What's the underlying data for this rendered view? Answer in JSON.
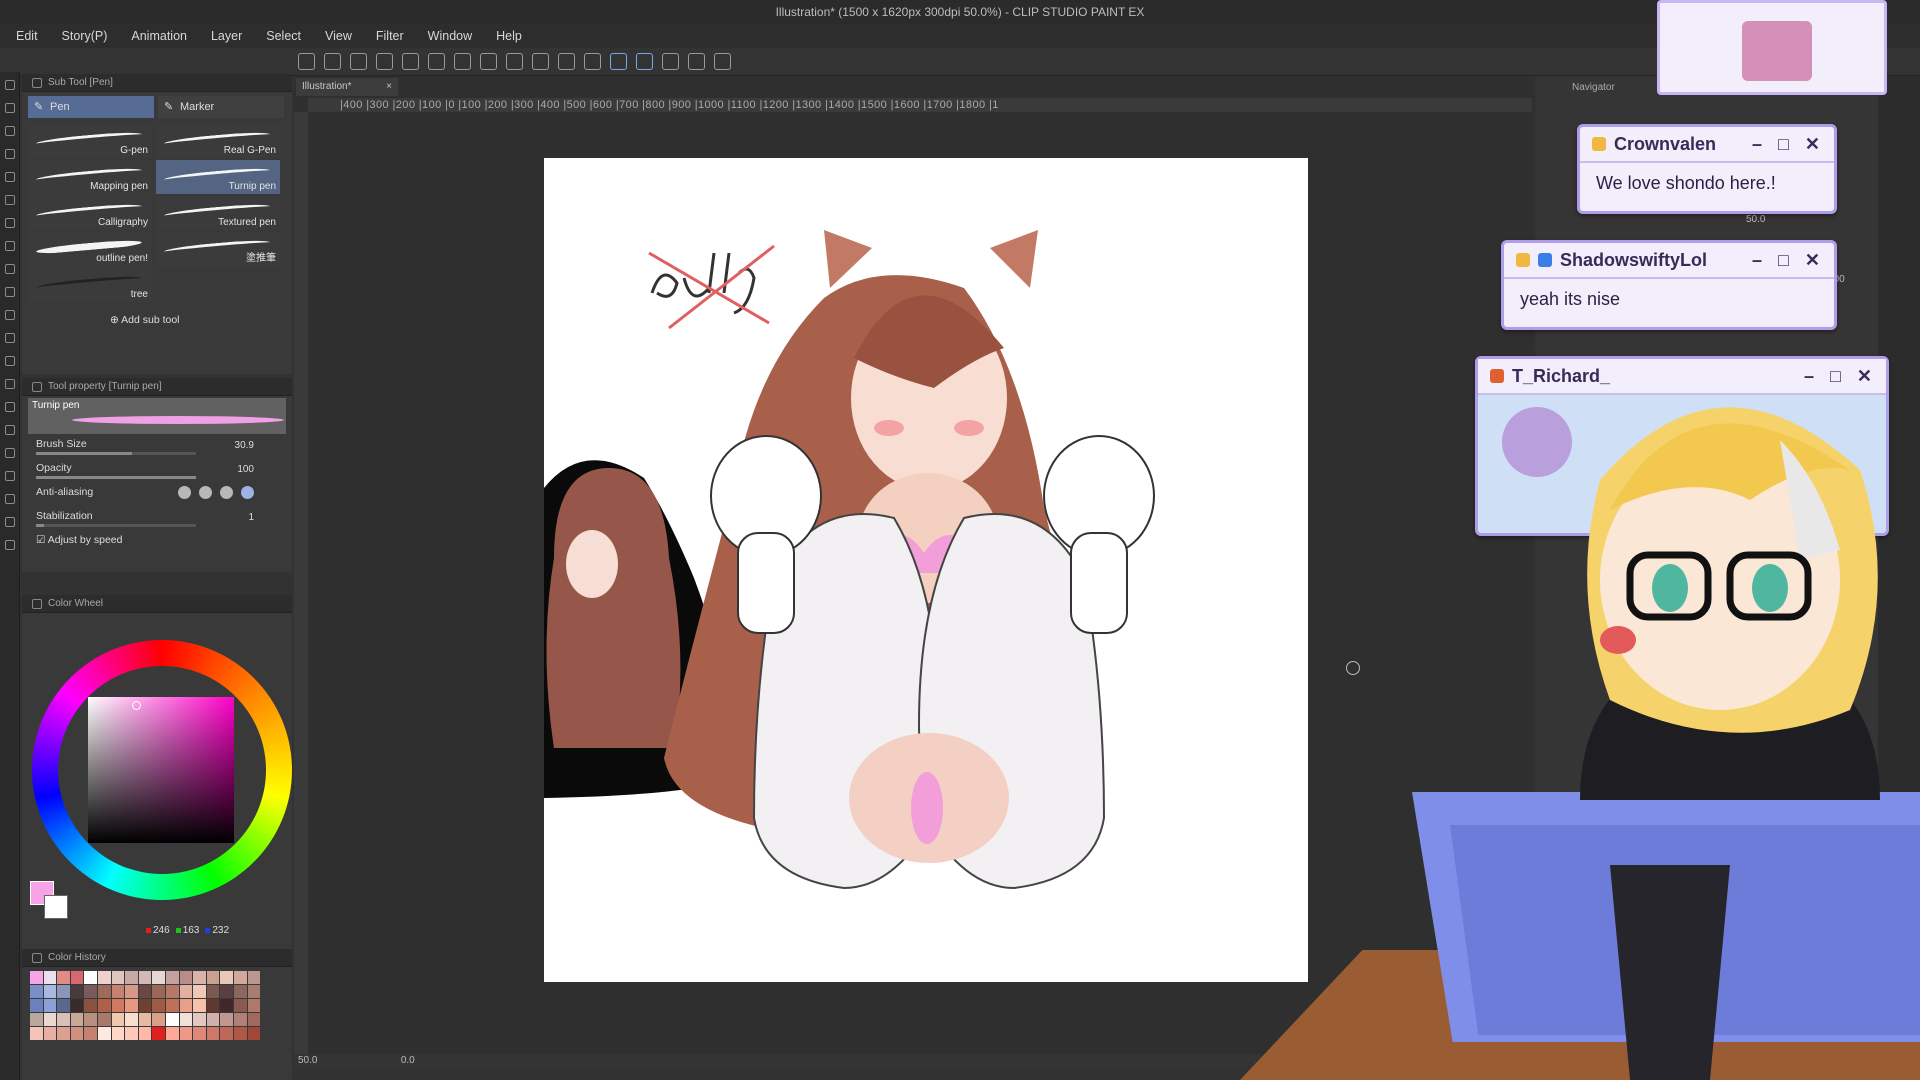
{
  "window": {
    "title": "Illustration* (1500 x 1620px 300dpi 50.0%) - CLIP STUDIO PAINT EX"
  },
  "menu": [
    "Edit",
    "Story(P)",
    "Animation",
    "Layer",
    "Select",
    "View",
    "Filter",
    "Window",
    "Help"
  ],
  "subtool": {
    "header": "Sub Tool [Pen]",
    "tabs": [
      "Pen",
      "Marker"
    ],
    "brushes": [
      "G-pen",
      "Real G-Pen",
      "Mapping pen",
      "Turnip pen",
      "Calligraphy",
      "Textured pen",
      "outline pen!",
      "塗推筆",
      "tree",
      ""
    ],
    "selected_brush": "Turnip pen",
    "add_label": "Add sub tool"
  },
  "tool_property": {
    "header": "Tool property [Turnip pen]",
    "name": "Turnip pen",
    "brush_size_label": "Brush Size",
    "brush_size": "30.9",
    "opacity_label": "Opacity",
    "opacity": "100",
    "antialiasing_label": "Anti-aliasing",
    "stabilization_label": "Stabilization",
    "stabilization": "1",
    "adjust_label": "Adjust by speed"
  },
  "color_wheel": {
    "header": "Color Wheel",
    "main_color": "#f6a3e8",
    "r": "246",
    "g": "163",
    "b": "232"
  },
  "color_history": {
    "header": "Color History",
    "swatches": [
      "#f6a3e8",
      "#e8e0ea",
      "#e28a84",
      "#d86870",
      "#ffffff",
      "#f0d0cc",
      "#e0c4c0",
      "#c8a8a4",
      "#d4b8b8",
      "#e6d6d6",
      "#c4a0a0",
      "#b88c88",
      "#d9b2a8",
      "#caa090",
      "#e8c8b8",
      "#d0a89c",
      "#b89890",
      "#7a8ec8",
      "#a8b8e0",
      "#8896b8",
      "#4a3a3a",
      "#7a5a5a",
      "#a06a5a",
      "#c88070",
      "#d89888",
      "#6a4840",
      "#9a6858",
      "#b87868",
      "#e0b0a0",
      "#f0c8b8",
      "#7a5a50",
      "#5a4040",
      "#8a6860",
      "#a87c70",
      "#6c80c0",
      "#8ca0d8",
      "#5a6890",
      "#3a2a2a",
      "#8a5040",
      "#b06048",
      "#d07860",
      "#e89880",
      "#704030",
      "#a05a48",
      "#c07058",
      "#e8a088",
      "#f8c0a8",
      "#603830",
      "#402828",
      "#8a5a50",
      "#b07868",
      "#b8a8a0",
      "#e8d8d0",
      "#d8c0b8",
      "#c8a898",
      "#b89080",
      "#a87868",
      "#f0c8b0",
      "#f8e0d0",
      "#e8b8a0",
      "#d8a088",
      "#ffffff",
      "#f0e0d8",
      "#e0c8c0",
      "#d0b0a8",
      "#c09890",
      "#b08078",
      "#a06860",
      "#f4c4b8",
      "#e8b0a4",
      "#dca090",
      "#d09080",
      "#c48070",
      "#ffe8e0",
      "#ffd8c8",
      "#ffc8b8",
      "#ffb8a8",
      "#e02020",
      "#ffa898",
      "#f09888",
      "#e08878",
      "#d07868",
      "#c06858",
      "#b05848",
      "#a04838"
    ]
  },
  "canvas": {
    "doc_tab": "Illustration*",
    "ruler": "|400  |300  |200  |100  |0   |100  |200  |300  |400  |500  |600  |700  |800  |900  |1000 |1100 |1200 |1300 |1400 |1500 |1600 |1700 |1800 |1",
    "zoom": "50.0",
    "angle": "0.0"
  },
  "navigator": {
    "header": "Navigator",
    "zoom": "50.0",
    "percent": "100"
  },
  "chat": [
    {
      "user": "Crownvalen",
      "message": "We love shondo here.!",
      "color": "#f0b840"
    },
    {
      "user": "ShadowswiftyLol",
      "message": "yeah its nise",
      "color": "#f0b840"
    },
    {
      "user": "T_Richard_",
      "message": "",
      "color": "#e06030"
    }
  ],
  "window_controls": {
    "min": "–",
    "max": "□",
    "close": "✕"
  }
}
